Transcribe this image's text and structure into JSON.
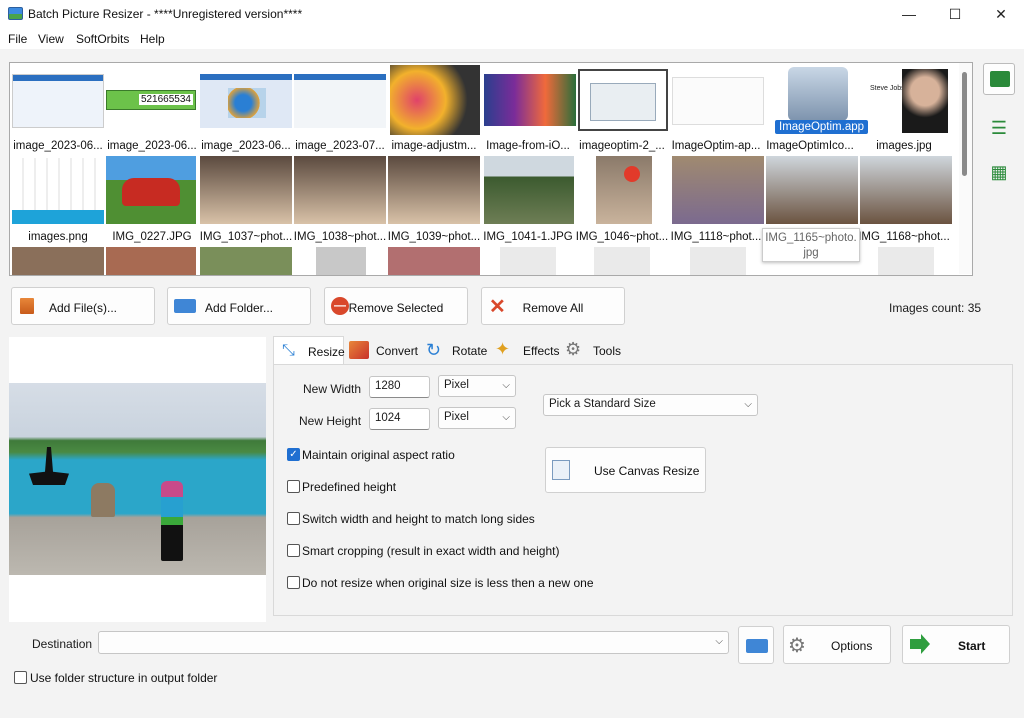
{
  "window": {
    "title": "Batch Picture Resizer - ****Unregistered version****",
    "minimize": "—",
    "maximize": "☐",
    "close": "✕"
  },
  "menu": [
    "File",
    "View",
    "SoftOrbits",
    "Help"
  ],
  "gallery": {
    "row1": [
      "image_2023-06...",
      "image_2023-06...",
      "image_2023-06...",
      "image_2023-07...",
      "image-adjustm...",
      "Image-from-iO...",
      "imageoptim-2_...",
      "ImageOptim-ap...",
      "ImageOptim.app",
      "images.jpg"
    ],
    "row2": [
      "images.png",
      "IMG_0227.JPG",
      "IMG_1037~phot...",
      "IMG_1038~phot...",
      "IMG_1039~phot...",
      "IMG_1041-1.JPG",
      "IMG_1046~phot...",
      "IMG_1118~phot...",
      "IMG_1165~photo.jpg",
      "IMG_1168~phot..."
    ],
    "row1_extra": "ImageOptimIco...",
    "barcode_number": "521665534",
    "tooltip_line1": "IMG_1165~photo.",
    "tooltip_line2": "jpg",
    "person_label": "Steve Jobs",
    "selected_label": "ImageOptim.app"
  },
  "toolbar": {
    "add_files": "Add File(s)...",
    "add_folder": "Add Folder...",
    "remove_selected": "Remove Selected",
    "remove_all": "Remove All",
    "images_count": "Images count: 35"
  },
  "tabs": [
    "Resize",
    "Convert",
    "Rotate",
    "Effects",
    "Tools"
  ],
  "resize": {
    "new_width_label": "New Width",
    "new_width": "1280",
    "width_unit": "Pixel",
    "new_height_label": "New Height",
    "new_height": "1024",
    "height_unit": "Pixel",
    "standard_size": "Pick a Standard Size",
    "canvas_resize": "Use Canvas Resize",
    "opt_aspect": "Maintain original aspect ratio",
    "opt_predefined": "Predefined height",
    "opt_switch": "Switch width and height to match long sides",
    "opt_smart": "Smart cropping (result in exact width and height)",
    "opt_noresize": "Do not resize when original size is less then a new one"
  },
  "bottom": {
    "destination_label": "Destination",
    "destination_value": "",
    "options": "Options",
    "start": "Start",
    "folder_structure": "Use folder structure in output folder"
  },
  "colors": {
    "accent": "#1f6fd1",
    "start_arrow": "#2f9e3f"
  }
}
